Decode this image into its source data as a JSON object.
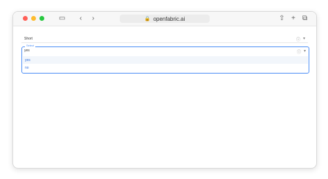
{
  "browser": {
    "url": "openfabric.ai",
    "icons": {
      "sidebar": "sidebar-icon",
      "back": "chevron-left-icon",
      "forward": "chevron-right-icon",
      "lock": "lock-icon",
      "share": "share-icon",
      "new_tab": "plus-icon",
      "tabs": "tabs-icon"
    }
  },
  "form": {
    "short_field": {
      "value": "Short"
    },
    "select": {
      "label": "Select",
      "value": "yes",
      "options": [
        "yes",
        "no"
      ]
    }
  }
}
